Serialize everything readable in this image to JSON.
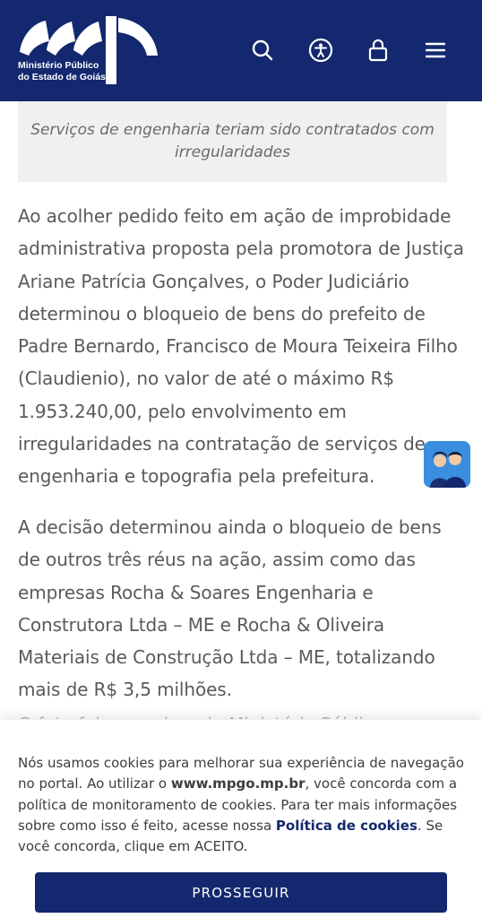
{
  "header": {
    "logo_line1": "Ministério Público",
    "logo_line2": "do Estado de Goiás",
    "bg_color": "#13286e",
    "icons": [
      "search-icon",
      "accessibility-icon",
      "lock-icon",
      "menu-icon"
    ]
  },
  "article": {
    "caption": "Serviços de engenharia teriam sido contratados com irregularidades",
    "paragraph1": "Ao acolher pedido feito em ação de improbidade administrativa proposta pela promotora de Justiça Ariane Patrícia Gonçalves, o Poder Judiciário determinou o bloqueio de bens do prefeito de Padre Bernardo, Francisco de Moura Teixeira Filho (Claudienio), no valor de até o máximo R$ 1.953.240,00, pelo envolvimento em irregularidades na contratação de serviços de engenharia e topografia pela prefeitura.",
    "paragraph2": "A decisão determinou ainda o bloqueio de bens de outros três réus na ação, assim como das empresas Rocha & Soares Engenharia e Construtora Ltda – ME e Rocha & Oliveira Materiais de Construção Ltda – ME, totalizando mais de R$ 3,5 milhões.",
    "paragraph3_partial": "O fato foi apurado pelo Ministério Público"
  },
  "cookie_banner": {
    "text_part1": "Nós usamos cookies para melhorar sua experiência de navegação no portal. Ao utilizar o ",
    "site_link": "www.mpgo.mp.br",
    "text_part2": ", você concorda com a política de monitoramento de cookies. Para ter mais informações sobre como isso é feito, acesse nossa ",
    "policy_link": "Política de cookies",
    "text_part3": ". Se você concorda, clique em ACEITO.",
    "button_label": "PROSSEGUIR"
  }
}
